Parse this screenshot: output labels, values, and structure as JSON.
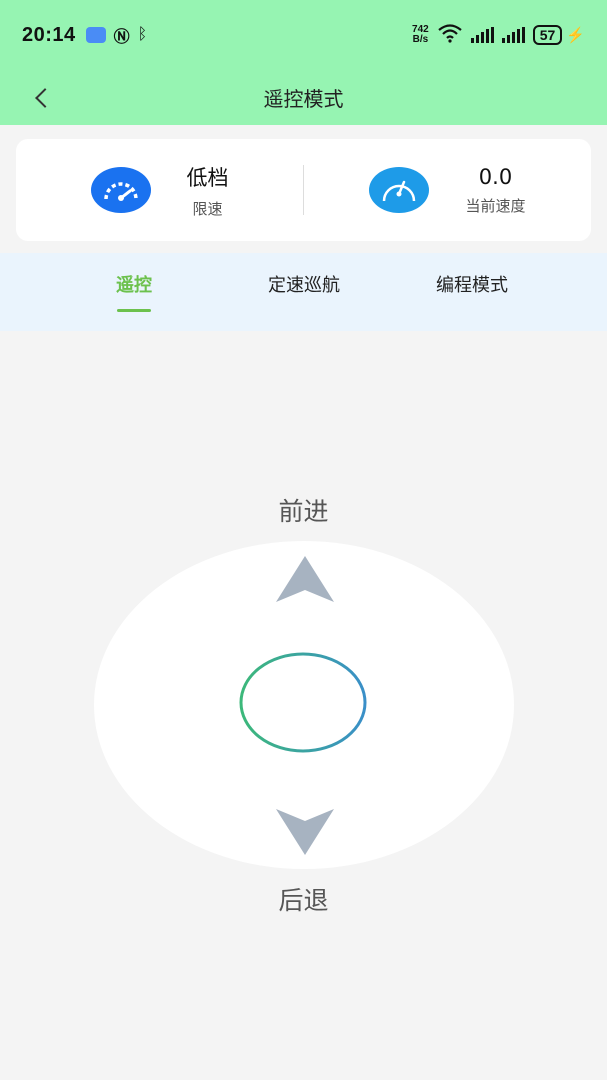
{
  "status_bar": {
    "time": "20:14",
    "net_speed_value": "742",
    "net_speed_unit": "B/s",
    "battery": "57",
    "icons": [
      "usb-icon",
      "nfc-icon",
      "bluetooth-icon",
      "wifi-icon",
      "signal-icon",
      "signal-icon",
      "battery-icon",
      "charging-icon"
    ]
  },
  "header": {
    "title": "遥控模式",
    "back_icon": "chevron-left-icon"
  },
  "speed_card": {
    "limit_value": "低档",
    "limit_label": "限速",
    "current_value": "0.0",
    "current_label": "当前速度",
    "icons": [
      "speedometer-icon",
      "gauge-icon"
    ]
  },
  "tabs": [
    {
      "label": "遥控",
      "active": true
    },
    {
      "label": "定速巡航",
      "active": false
    },
    {
      "label": "编程模式",
      "active": false
    }
  ],
  "joystick": {
    "forward_label": "前进",
    "backward_label": "后退",
    "icons": [
      "arrow-up-icon",
      "arrow-down-icon",
      "joystick-knob"
    ]
  },
  "colors": {
    "header_bg": "#96f4b2",
    "accent": "#6cc14d",
    "tab_bg": "#eaf4fd",
    "arrow": "#a7b3c1",
    "gauge_blue": "#1a72f0",
    "gauge_cyan": "#1e9be8"
  }
}
